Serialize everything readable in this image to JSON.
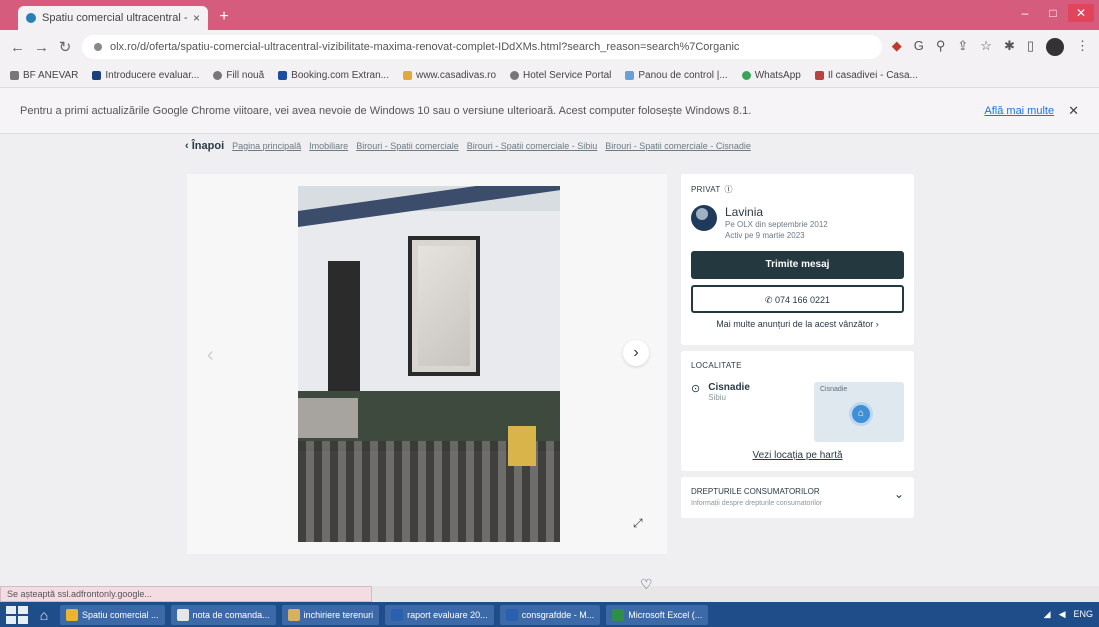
{
  "browser": {
    "tab_title": "Spatiu comercial ultracentral - ...",
    "tab_close": "×",
    "new_tab": "+",
    "url": "olx.ro/d/oferta/spatiu-comercial-ultracentral-vizibilitate-maxima-renovat-complet-IDdXMs.html?search_reason=search%7Corganic",
    "bookmarks": [
      "BF ANEVAR",
      "Introducere evaluar...",
      "Fill nouă",
      "Booking.com Extran...",
      "www.casadivas.ro",
      "Hotel Service Portal",
      "Panou de control |...",
      "WhatsApp",
      "Il casadivei - Casa..."
    ],
    "infobar_text": "Pentru a primi actualizările Google Chrome viitoare, vei avea nevoie de Windows 10 sau o versiune ulterioară. Acest computer folosește Windows 8.1.",
    "infobar_link": "Află mai multe",
    "infobar_close": "✕"
  },
  "page": {
    "back_label": "Înapoi",
    "breadcrumbs": [
      "Pagina principală",
      "Imobiliare",
      "Birouri - Spatii comerciale",
      "Birouri - Spatii comerciale - Sibiu",
      "Birouri - Spatii comerciale - Cisnadie"
    ],
    "seller_type": "PRIVAT",
    "seller_name": "Lavinia",
    "seller_since": "Pe OLX din septembrie 2012",
    "seller_online": "Activ pe 9 martie 2023",
    "send_message": "Trimite mesaj",
    "phone": "074 166 0221",
    "more_ads": "Mai multe anunțuri de la acest vânzător",
    "location_label": "LOCALITATE",
    "city": "Cisnadie",
    "county": "Sibiu",
    "map_label": "Cisnadie",
    "map_link": "Vezi locația pe hartă",
    "rights_title": "DREPTURILE CONSUMATORILOR",
    "rights_sub": "Informații despre drepturile consumatorilor"
  },
  "status_bar": "Se așteaptă ssl.adfrontonly.google...",
  "taskbar": {
    "items": [
      "Spatiu comercial ...",
      "nota de comanda...",
      "inchiriere terenuri",
      "raport evaluare 20...",
      "consgrafdde - M...",
      "Microsoft Excel (..."
    ],
    "tray": "ENG"
  },
  "colors": {
    "tabstrip": "#d65c7d",
    "taskbar": "#1e4d8a",
    "primary_button": "#23383f"
  }
}
